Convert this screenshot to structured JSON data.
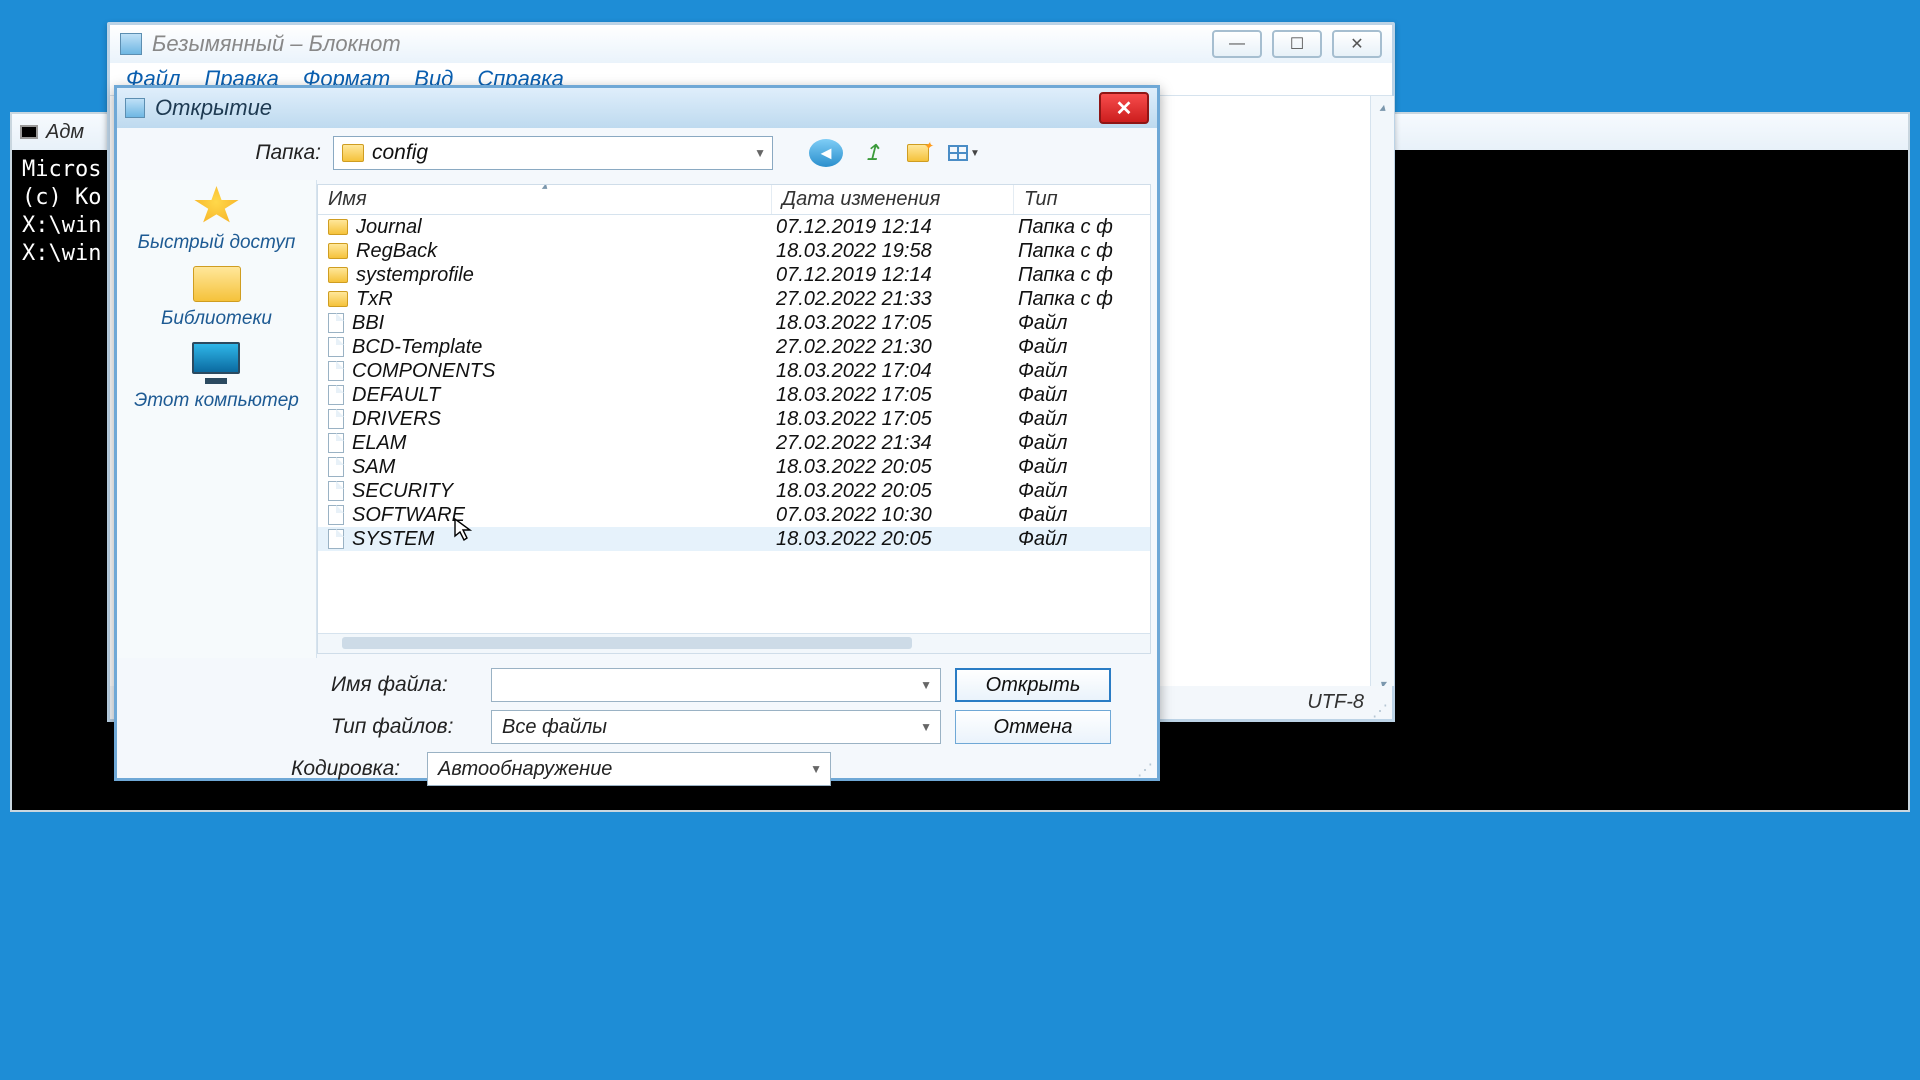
{
  "console": {
    "title": "Адм",
    "lines": [
      "Micros",
      "(c) Ко",
      "",
      "X:\\win",
      "",
      "X:\\win"
    ]
  },
  "notepad": {
    "title": "Безымянный – Блокнот",
    "menu": [
      "Файл",
      "Правка",
      "Формат",
      "Вид",
      "Справка"
    ],
    "status_encoding": "UTF-8"
  },
  "dialog": {
    "title": "Открытие",
    "look_in_label": "Папка:",
    "folder": "config",
    "places": {
      "quick": "Быстрый доступ",
      "libraries": "Библиотеки",
      "thispc": "Этот компьютер"
    },
    "columns": {
      "name": "Имя",
      "date": "Дата изменения",
      "type": "Тип"
    },
    "rows": [
      {
        "icon": "folder",
        "name": "Journal",
        "date": "07.12.2019 12:14",
        "type": "Папка с ф"
      },
      {
        "icon": "folder",
        "name": "RegBack",
        "date": "18.03.2022 19:58",
        "type": "Папка с ф"
      },
      {
        "icon": "folder",
        "name": "systemprofile",
        "date": "07.12.2019 12:14",
        "type": "Папка с ф"
      },
      {
        "icon": "folder",
        "name": "TxR",
        "date": "27.02.2022 21:33",
        "type": "Папка с ф"
      },
      {
        "icon": "file",
        "name": "BBI",
        "date": "18.03.2022 17:05",
        "type": "Файл"
      },
      {
        "icon": "file",
        "name": "BCD-Template",
        "date": "27.02.2022 21:30",
        "type": "Файл"
      },
      {
        "icon": "file",
        "name": "COMPONENTS",
        "date": "18.03.2022 17:04",
        "type": "Файл"
      },
      {
        "icon": "file",
        "name": "DEFAULT",
        "date": "18.03.2022 17:05",
        "type": "Файл"
      },
      {
        "icon": "file",
        "name": "DRIVERS",
        "date": "18.03.2022 17:05",
        "type": "Файл"
      },
      {
        "icon": "file",
        "name": "ELAM",
        "date": "27.02.2022 21:34",
        "type": "Файл"
      },
      {
        "icon": "file",
        "name": "SAM",
        "date": "18.03.2022 20:05",
        "type": "Файл"
      },
      {
        "icon": "file",
        "name": "SECURITY",
        "date": "18.03.2022 20:05",
        "type": "Файл"
      },
      {
        "icon": "file",
        "name": "SOFTWARE",
        "date": "07.03.2022 10:30",
        "type": "Файл"
      },
      {
        "icon": "file",
        "name": "SYSTEM",
        "date": "18.03.2022 20:05",
        "type": "Файл",
        "hover": true
      }
    ],
    "filename_label": "Имя файла:",
    "filetype_label": "Тип файлов:",
    "encoding_label": "Кодировка:",
    "filename_value": "",
    "filetype_value": "Все файлы",
    "encoding_value": "Автообнаружение",
    "open": "Открыть",
    "cancel": "Отмена"
  }
}
